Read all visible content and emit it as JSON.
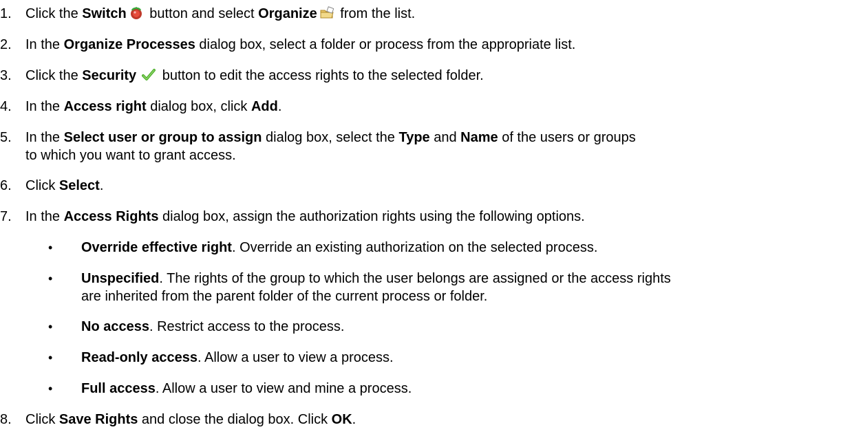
{
  "steps": [
    {
      "num": "1.",
      "t0": "Click the ",
      "b0": "Switch",
      "icon0": "switch-icon",
      "t1": " button and select ",
      "b1": "Organize",
      "icon1": "organize-icon",
      "t2": " from the list."
    },
    {
      "num": "2.",
      "t0": "In the ",
      "b0": "Organize Processes",
      "t1": " dialog box, select a folder or process from the appropriate list."
    },
    {
      "num": "3.",
      "t0": "Click the ",
      "b0": "Security",
      "icon0": "security-checkmark-icon",
      "t1": " button to edit the access rights to the selected folder."
    },
    {
      "num": "4.",
      "t0": "In the ",
      "b0": "Access right",
      "t1": " dialog box, click ",
      "b1": "Add",
      "t2": "."
    },
    {
      "num": "5.",
      "t0": "In the ",
      "b0": "Select user or group to assign",
      "t1": " dialog box, select the ",
      "b1": "Type",
      "t2": " and ",
      "b2": "Name",
      "t3": " of the users or groups",
      "t4": "to which you want to grant access."
    },
    {
      "num": "6.",
      "t0": "Click ",
      "b0": "Select",
      "t1": "."
    },
    {
      "num": "7.",
      "t0": "In the ",
      "b0": "Access Rights",
      "t1": " dialog box, assign the authorization rights using the following options."
    },
    {
      "num": "8.",
      "t0": "Click ",
      "b0": "Save Rights",
      "t1": " and close the dialog box. Click ",
      "b1": "OK",
      "t2": "."
    }
  ],
  "bullet_char": "•",
  "options": [
    {
      "term": "Override effective right",
      "desc": ". Override an existing authorization on the selected process."
    },
    {
      "term": "Unspecified",
      "desc": ". The rights of the group to which the user belongs are assigned or the access rights",
      "desc2": "are inherited from the parent folder of the current process or folder."
    },
    {
      "term": "No access",
      "desc": ". Restrict access to the process."
    },
    {
      "term": "Read-only access",
      "desc": ". Allow a user to view a process."
    },
    {
      "term": "Full access",
      "desc": ". Allow a user to view and mine a process."
    }
  ]
}
